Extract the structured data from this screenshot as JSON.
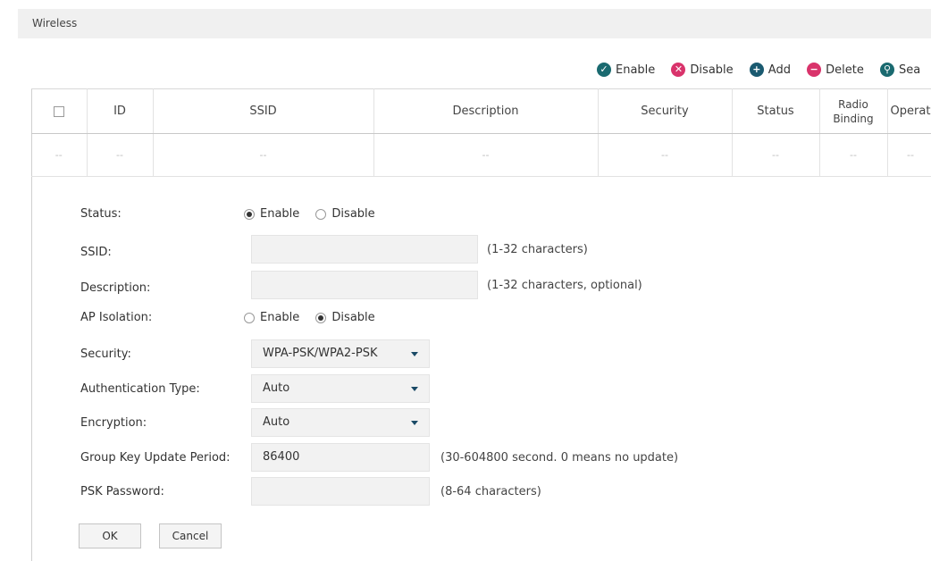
{
  "header": {
    "title": "Wireless"
  },
  "toolbar": {
    "enable": "Enable",
    "disable": "Disable",
    "add": "Add",
    "delete": "Delete",
    "search": "Sea"
  },
  "colors": {
    "enable": "#1a6a70",
    "disable": "#d9336b",
    "add": "#1a5a70",
    "delete": "#d9336b",
    "search": "#1a6a70"
  },
  "table": {
    "columns": [
      "ID",
      "SSID",
      "Description",
      "Security",
      "Status",
      "Radio Binding",
      "Operat"
    ],
    "empty_cell": "--"
  },
  "form": {
    "status": {
      "label": "Status:",
      "options": [
        "Enable",
        "Disable"
      ],
      "selected": "Enable"
    },
    "ssid": {
      "label": "SSID:",
      "value": "",
      "hint": "(1-32 characters)"
    },
    "description": {
      "label": "Description:",
      "value": "",
      "hint": "(1-32 characters, optional)"
    },
    "ap_isolation": {
      "label": "AP Isolation:",
      "options": [
        "Enable",
        "Disable"
      ],
      "selected": "Disable"
    },
    "security": {
      "label": "Security:",
      "value": "WPA-PSK/WPA2-PSK"
    },
    "auth_type": {
      "label": "Authentication Type:",
      "value": "Auto"
    },
    "encryption": {
      "label": "Encryption:",
      "value": "Auto"
    },
    "group_key": {
      "label": "Group Key Update Period:",
      "value": "86400",
      "hint": "(30-604800 second. 0 means no update)"
    },
    "psk_password": {
      "label": "PSK Password:",
      "value": "",
      "hint": "(8-64 characters)"
    }
  },
  "buttons": {
    "ok": "OK",
    "cancel": "Cancel"
  }
}
